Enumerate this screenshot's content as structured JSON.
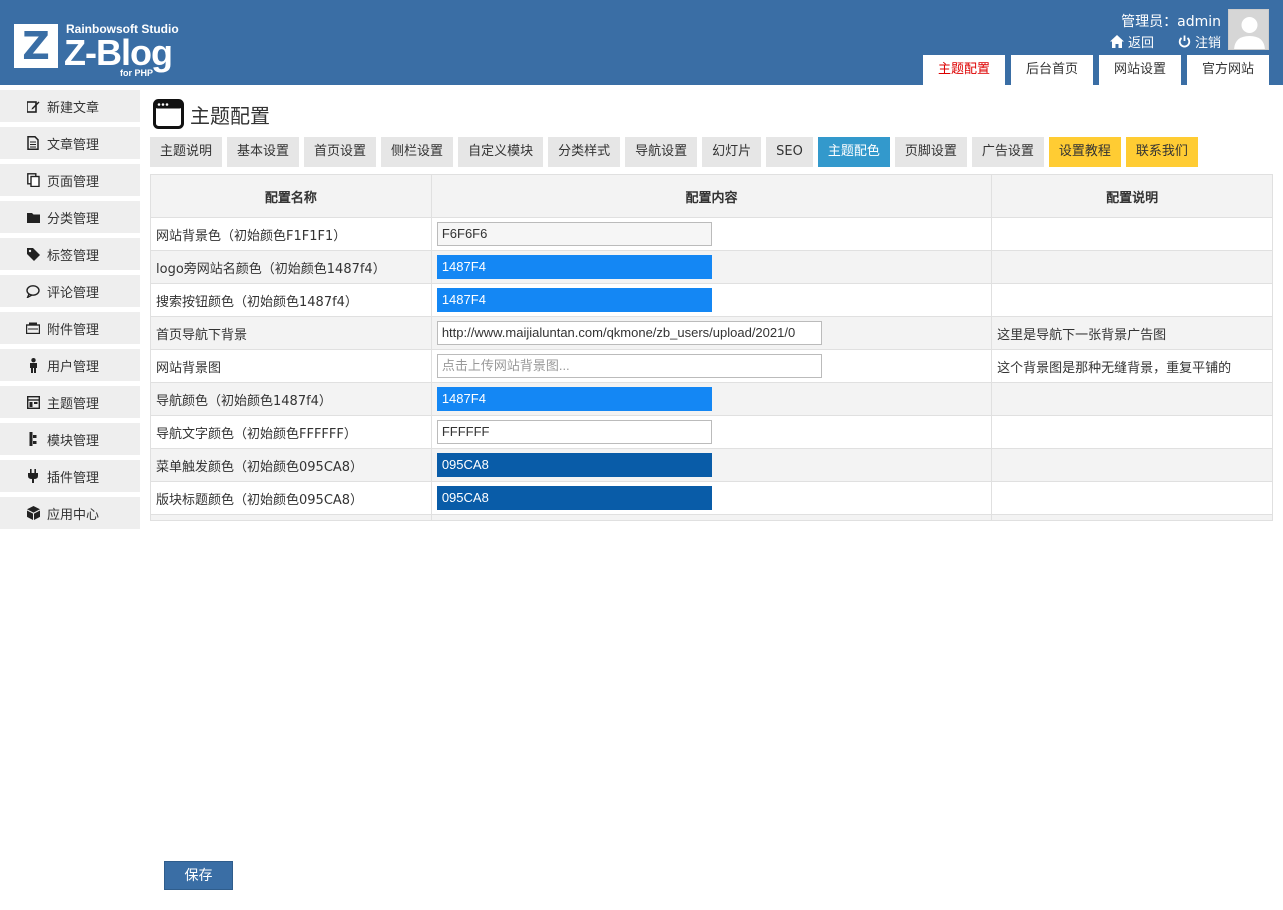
{
  "header": {
    "logo": {
      "studio": "Rainbowsoft Studio",
      "name": "Z-Blog",
      "sub": "for PHP",
      "mark": "Z"
    },
    "user_label": "管理员：admin",
    "back_label": "返回",
    "logout_label": "注销",
    "tabs": [
      {
        "label": "主题配置",
        "active": true
      },
      {
        "label": "后台首页"
      },
      {
        "label": "网站设置"
      },
      {
        "label": "官方网站"
      }
    ]
  },
  "sidebar": {
    "items": [
      {
        "label": "新建文章",
        "icon": "edit-icon"
      },
      {
        "label": "文章管理",
        "icon": "document-icon"
      },
      {
        "label": "页面管理",
        "icon": "pages-icon"
      },
      {
        "label": "分类管理",
        "icon": "folder-icon"
      },
      {
        "label": "标签管理",
        "icon": "tag-icon"
      },
      {
        "label": "评论管理",
        "icon": "comment-icon"
      },
      {
        "label": "附件管理",
        "icon": "attachment-icon"
      },
      {
        "label": "用户管理",
        "icon": "user-icon"
      },
      {
        "label": "主题管理",
        "icon": "theme-icon"
      },
      {
        "label": "模块管理",
        "icon": "module-icon"
      },
      {
        "label": "插件管理",
        "icon": "plugin-icon"
      },
      {
        "label": "应用中心",
        "icon": "cube-icon"
      }
    ]
  },
  "main": {
    "title": "主题配置",
    "tabs": [
      {
        "label": "主题说明"
      },
      {
        "label": "基本设置"
      },
      {
        "label": "首页设置"
      },
      {
        "label": "侧栏设置"
      },
      {
        "label": "自定义模块"
      },
      {
        "label": "分类样式"
      },
      {
        "label": "导航设置"
      },
      {
        "label": "幻灯片"
      },
      {
        "label": "SEO"
      },
      {
        "label": "主题配色",
        "active": true
      },
      {
        "label": "页脚设置"
      },
      {
        "label": "广告设置"
      },
      {
        "label": "设置教程",
        "highlight": true
      },
      {
        "label": "联系我们",
        "highlight": true
      }
    ],
    "table": {
      "headers": [
        "配置名称",
        "配置内容",
        "配置说明"
      ],
      "rows": [
        {
          "name": "网站背景色（初始颜色F1F1F1）",
          "value": "F6F6F6",
          "bg": "#f6f6f6",
          "fg": "#333333",
          "desc": ""
        },
        {
          "name": "logo旁网站名颜色（初始颜色1487f4）",
          "value": "1487F4",
          "bg": "#1487f4",
          "fg": "#ffffff",
          "desc": ""
        },
        {
          "name": "搜索按钮颜色（初始颜色1487f4）",
          "value": "1487F4",
          "bg": "#1487f4",
          "fg": "#ffffff",
          "desc": ""
        },
        {
          "name": "首页导航下背景",
          "value": "http://www.maijialuntan.com/qkmone/zb_users/upload/2021/0",
          "desc": "这里是导航下一张背景广告图",
          "long": true
        },
        {
          "name": "网站背景图",
          "placeholder": "点击上传网站背景图...",
          "desc": "这个背景图是那种无缝背景，重复平铺的",
          "long": true
        },
        {
          "name": "导航颜色（初始颜色1487f4）",
          "value": "1487F4",
          "bg": "#1487f4",
          "fg": "#ffffff",
          "desc": ""
        },
        {
          "name": "导航文字颜色（初始颜色FFFFFF）",
          "value": "FFFFFF",
          "bg": "#ffffff",
          "fg": "#333333",
          "desc": ""
        },
        {
          "name": "菜单触发颜色（初始颜色095CA8）",
          "value": "095CA8",
          "bg": "#095ca8",
          "fg": "#ffffff",
          "desc": ""
        },
        {
          "name": "版块标题颜色（初始颜色095CA8）",
          "value": "095CA8",
          "bg": "#095ca8",
          "fg": "#ffffff",
          "desc": ""
        }
      ]
    },
    "save_label": "保存"
  },
  "colors": {
    "header": "#3a6ea5",
    "active_tab": "#3399cc",
    "highlight_tab": "#ffcc33",
    "active_top_tab_text": "#dd0000"
  }
}
